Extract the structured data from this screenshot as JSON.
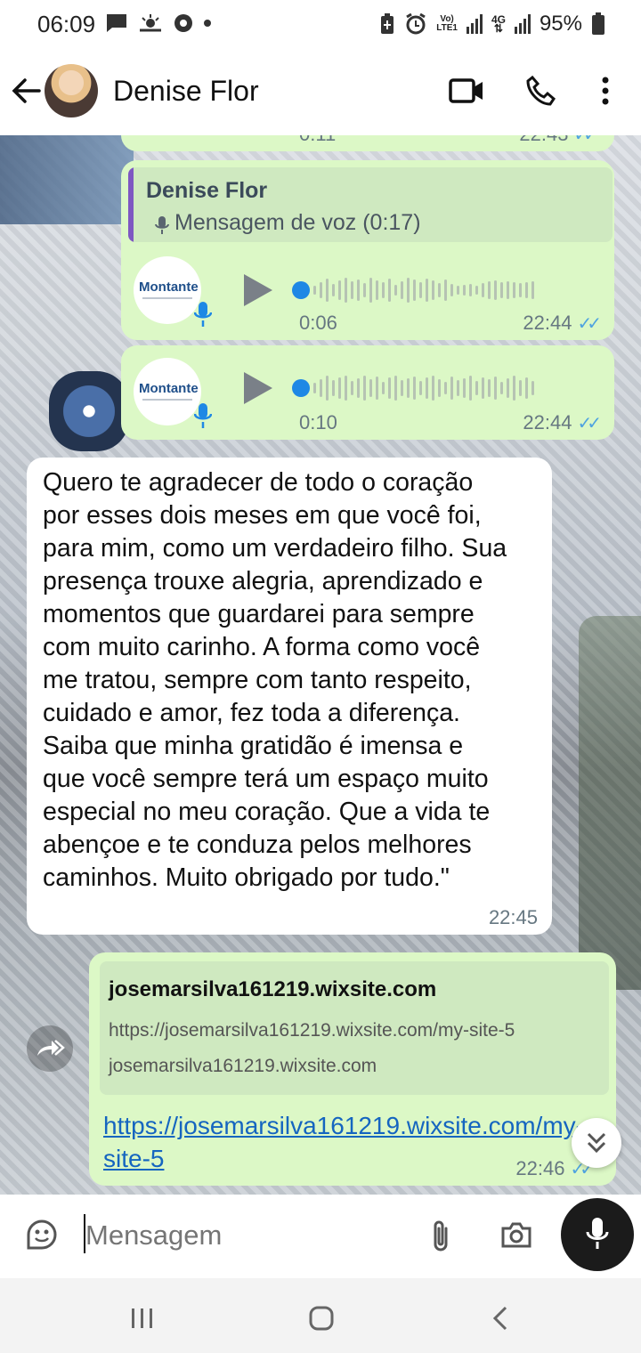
{
  "status_bar": {
    "time": "06:09",
    "battery": "95%",
    "icons": [
      "message-icon",
      "weather-icon",
      "soccer-icon",
      "dot-icon",
      "battery-saver-icon",
      "alarm-icon",
      "volte-icon",
      "signal-icon",
      "4g-icon",
      "signal-icon",
      "battery-icon"
    ],
    "volte_label_top": "Vo)",
    "volte_label_bottom": "LTE1",
    "network_top": "4G"
  },
  "header": {
    "contact_name": "Denise Flor",
    "icons": [
      "back-arrow-icon",
      "video-call-icon",
      "phone-icon",
      "more-icon"
    ]
  },
  "messages": {
    "partial_top": {
      "duration": "0:11",
      "time": "22:43"
    },
    "voice_reply": {
      "quoted_name": "Denise Flor",
      "quoted_text": "Mensagem de voz (0:17)",
      "logo_text": "Montante",
      "duration": "0:06",
      "time": "22:44"
    },
    "voice_2": {
      "logo_text": "Montante",
      "duration": "0:10",
      "time": "22:44"
    },
    "incoming_text": {
      "lines": [
        "Quero te agradecer de todo o coração",
        "por esses dois meses em que você foi,",
        "para mim, como um verdadeiro filho. Sua",
        "presença trouxe alegria, aprendizado e",
        "momentos que guardarei para sempre",
        "com muito carinho. A forma como você",
        "me tratou, sempre com tanto respeito,",
        "cuidado e amor, fez toda a diferença.",
        "Saiba que minha gratidão é imensa e",
        "que você sempre terá um espaço muito",
        "especial no meu coração. Que a vida te",
        "abençoe e te conduza pelos melhores",
        "caminhos. Muito obrigado por tudo.\""
      ],
      "time": "22:45"
    },
    "link_message": {
      "preview_title": "josemarsilva161219.wixsite.com",
      "preview_url": "https://josemarsilva161219.wixsite.com/my-site-5",
      "preview_domain": "josemarsilva161219.wixsite.com",
      "link_text": "https://josemarsilva161219.wixsite.com/my-site-5",
      "time": "22:46"
    }
  },
  "input": {
    "placeholder": "Mensagem"
  },
  "colors": {
    "outgoing_bubble": "#dcf8c6",
    "incoming_bubble": "#ffffff",
    "read_ticks": "#4fa3e0",
    "link": "#1565c0"
  }
}
